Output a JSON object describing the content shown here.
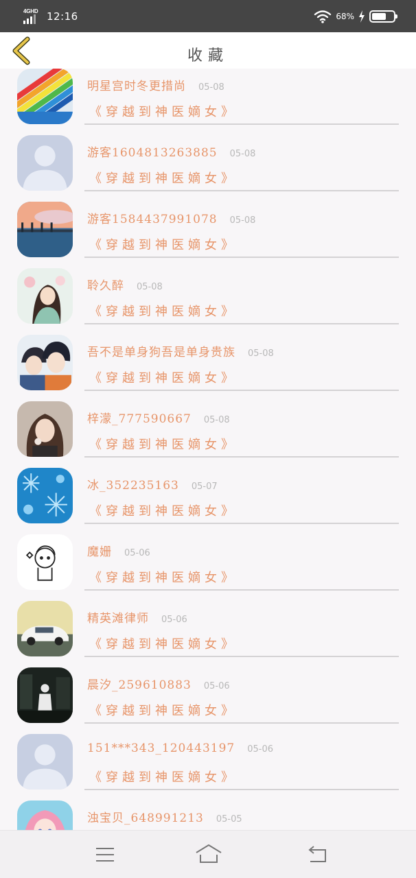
{
  "status_bar": {
    "network": "4GHD",
    "time": "12:16",
    "battery_text": "68%",
    "battery_level": 0.68,
    "icons": [
      "signal-icon",
      "wifi-icon",
      "charging-icon",
      "battery-icon"
    ]
  },
  "header": {
    "title": "收藏",
    "back_icon": "chevron-left-icon"
  },
  "list": {
    "items": [
      {
        "name": "明星宫时冬更措尚",
        "date": "05-08",
        "book": "《穿越到神医嫡女》",
        "avatar": "rainbow-crayons"
      },
      {
        "name": "游客1604813263885",
        "date": "05-08",
        "book": "《穿越到神医嫡女》",
        "avatar": "default-person"
      },
      {
        "name": "游客1584437991078",
        "date": "05-08",
        "book": "《穿越到神医嫡女》",
        "avatar": "pier-sunset"
      },
      {
        "name": "聆久醉",
        "date": "05-08",
        "book": "《穿越到神医嫡女》",
        "avatar": "anime-girl-flowers"
      },
      {
        "name": "吾不是单身狗吾是单身贵族",
        "date": "05-08",
        "book": "《穿越到神医嫡女》",
        "avatar": "anime-boys"
      },
      {
        "name": "梓濛_777590667",
        "date": "05-08",
        "book": "《穿越到神医嫡女》",
        "avatar": "girl-photo"
      },
      {
        "name": "冰_352235163",
        "date": "05-07",
        "book": "《穿越到神医嫡女》",
        "avatar": "snowflakes"
      },
      {
        "name": "魔姗",
        "date": "05-06",
        "book": "《穿越到神医嫡女》",
        "avatar": "doodle"
      },
      {
        "name": "精英滩律师",
        "date": "05-06",
        "book": "《穿越到神医嫡女》",
        "avatar": "white-car"
      },
      {
        "name": "晨汐_259610883",
        "date": "05-06",
        "book": "《穿越到神医嫡女》",
        "avatar": "dark-city"
      },
      {
        "name": "151***343_120443197",
        "date": "05-06",
        "book": "《穿越到神医嫡女》",
        "avatar": "default-person"
      },
      {
        "name": "浊宝贝_648991213",
        "date": "05-05",
        "book": "《穿越到神医嫡女》",
        "avatar": "pink-hair-anime"
      }
    ]
  },
  "nav_bar": {
    "icons": [
      "menu-icon",
      "home-icon",
      "back-icon"
    ]
  }
}
